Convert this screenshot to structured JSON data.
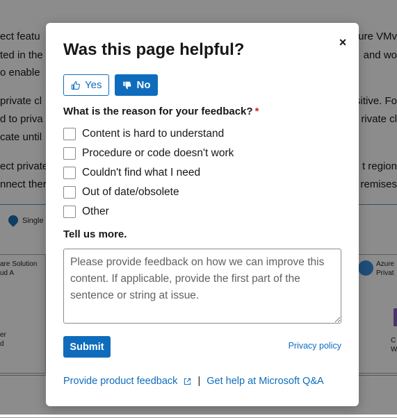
{
  "background": {
    "left_lines": [
      "ect featu",
      "ted in the",
      "o enable",
      "private cl",
      "d to priva",
      "cate until",
      "ect private",
      "nnect ther"
    ],
    "right_lines": [
      "ure VMv",
      "and wo",
      "sitive. Fo",
      "rivate cl",
      "t region",
      "remises"
    ],
    "diagram_labels": {
      "single": "Single",
      "left_box_1": "are Solution",
      "left_box_2": "ud A",
      "right_box_1": "Azure",
      "right_box_2": "Privat",
      "left_small_1": "er",
      "left_small_2": "d",
      "right_small_1": "C",
      "right_small_2": "W"
    }
  },
  "modal": {
    "title": "Was this page helpful?",
    "close_label": "×",
    "yes_label": "Yes",
    "no_label": "No",
    "question": "What is the reason for your feedback?",
    "required_mark": "*",
    "options": [
      "Content is hard to understand",
      "Procedure or code doesn't work",
      "Couldn't find what I need",
      "Out of date/obsolete",
      "Other"
    ],
    "tell_more": "Tell us more.",
    "textarea_placeholder": "Please provide feedback on how we can improve this content. If applicable, provide the first part of the sentence or string at issue.",
    "submit_label": "Submit",
    "privacy_label": "Privacy policy",
    "product_feedback_label": "Provide product feedback",
    "separator": "|",
    "qna_label": "Get help at Microsoft Q&A"
  },
  "colors": {
    "accent": "#0f6cbd",
    "required": "#c62828",
    "overlay": "rgba(0,0,0,0.45)"
  }
}
